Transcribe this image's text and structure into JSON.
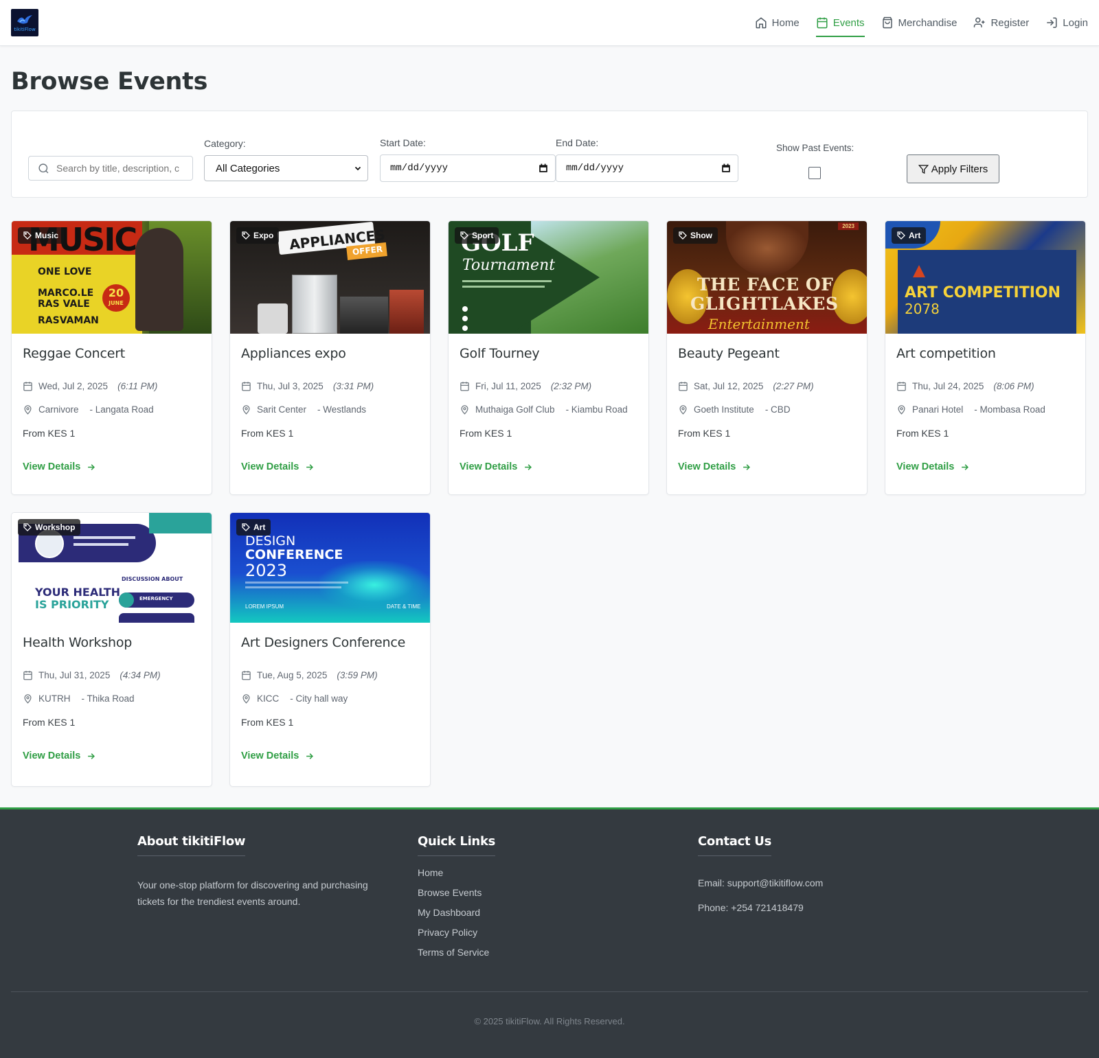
{
  "brand": {
    "logo_text": "tikitiFlow"
  },
  "nav": [
    {
      "label": "Home",
      "icon": "home-icon",
      "active": false
    },
    {
      "label": "Events",
      "icon": "calendar-icon",
      "active": true
    },
    {
      "label": "Merchandise",
      "icon": "shopping-bag-icon",
      "active": false
    },
    {
      "label": "Register",
      "icon": "user-plus-icon",
      "active": false
    },
    {
      "label": "Login",
      "icon": "login-icon",
      "active": false
    }
  ],
  "page": {
    "title": "Browse Events"
  },
  "filters": {
    "search_placeholder": "Search by title, description, c",
    "category_label": "Category:",
    "category_value": "All Categories",
    "start_label": "Start Date:",
    "start_value": "mm/dd/yyyy",
    "end_label": "End Date:",
    "end_value": "mm/dd/yyyy",
    "past_label": "Show Past Events:",
    "past_checked": false,
    "apply_label": "Apply Filters"
  },
  "events": [
    {
      "badge": "Music",
      "title": "Reggae Concert",
      "date": "Wed, Jul 2, 2025",
      "time": "(6:11 PM)",
      "venue": "Carnivore",
      "area": "- Langata Road",
      "price": "From KES 1",
      "cta": "View Details",
      "poster": {
        "line1": "MUSIC",
        "line2": "ONE LOVE",
        "line3": "MARCO.LE",
        "line4": "RAS VALE",
        "line5": "RASVAMAN",
        "date_badge": "20",
        "date_month": "JUNE"
      }
    },
    {
      "badge": "Expo",
      "title": "Appliances expo",
      "date": "Thu, Jul 3, 2025",
      "time": "(3:31 PM)",
      "venue": "Sarit Center",
      "area": "- Westlands",
      "price": "From KES 1",
      "cta": "View Details",
      "poster": {
        "line1": "APPLIANCES",
        "line2": "OFFER"
      }
    },
    {
      "badge": "Sport",
      "title": "Golf Tourney",
      "date": "Fri, Jul 11, 2025",
      "time": "(2:32 PM)",
      "venue": "Muthaiga Golf Club",
      "area": "- Kiambu Road",
      "price": "From KES 1",
      "cta": "View Details",
      "poster": {
        "line1": "GOLF",
        "line2": "Tournament"
      }
    },
    {
      "badge": "Show",
      "title": "Beauty Pegeant",
      "date": "Sat, Jul 12, 2025",
      "time": "(2:27 PM)",
      "venue": "Goeth Institute",
      "area": "- CBD",
      "price": "From KES 1",
      "cta": "View Details",
      "poster": {
        "line1": "THE FACE OF",
        "line2": "GLIGHTLAKES",
        "line3": "Entertainment",
        "year": "2023"
      }
    },
    {
      "badge": "Art",
      "title": "Art competition",
      "date": "Thu, Jul 24, 2025",
      "time": "(8:06 PM)",
      "venue": "Panari Hotel",
      "area": "- Mombasa Road",
      "price": "From KES 1",
      "cta": "View Details",
      "poster": {
        "line1": "ART COMPETITION",
        "line2": "2078"
      }
    },
    {
      "badge": "Workshop",
      "title": "Health Workshop",
      "date": "Thu, Jul 31, 2025",
      "time": "(4:34 PM)",
      "venue": "KUTRH",
      "area": "- Thika Road",
      "price": "From KES 1",
      "cta": "View Details",
      "poster": {
        "line1": "YOUR HEALTH",
        "line2": "IS PRIORITY",
        "line3": "DISCUSSION ABOUT",
        "line4": "EMERGENCY"
      }
    },
    {
      "badge": "Art",
      "title": "Art Designers Conference",
      "date": "Tue, Aug 5, 2025",
      "time": "(3:59 PM)",
      "venue": "KICC",
      "area": "- City hall way",
      "price": "From KES 1",
      "cta": "View Details",
      "poster": {
        "line1": "DESIGN",
        "line2": "CONFERENCE",
        "line3": "2023",
        "line4": "LOREM IPSUM",
        "line5": "DATE & TIME"
      }
    }
  ],
  "footer": {
    "about_title": "About tikitiFlow",
    "about_text": "Your one-stop platform for discovering and purchasing tickets for the trendiest events around.",
    "links_title": "Quick Links",
    "links": [
      "Home",
      "Browse Events",
      "My Dashboard",
      "Privacy Policy",
      "Terms of Service"
    ],
    "contact_title": "Contact Us",
    "email": "Email: support@tikitiflow.com",
    "phone": "Phone: +254 721418479",
    "copyright": "© 2025 tikitiFlow. All Rights Reserved."
  },
  "colors": {
    "accent": "#2f9e44",
    "footer_bg": "#343a40"
  }
}
